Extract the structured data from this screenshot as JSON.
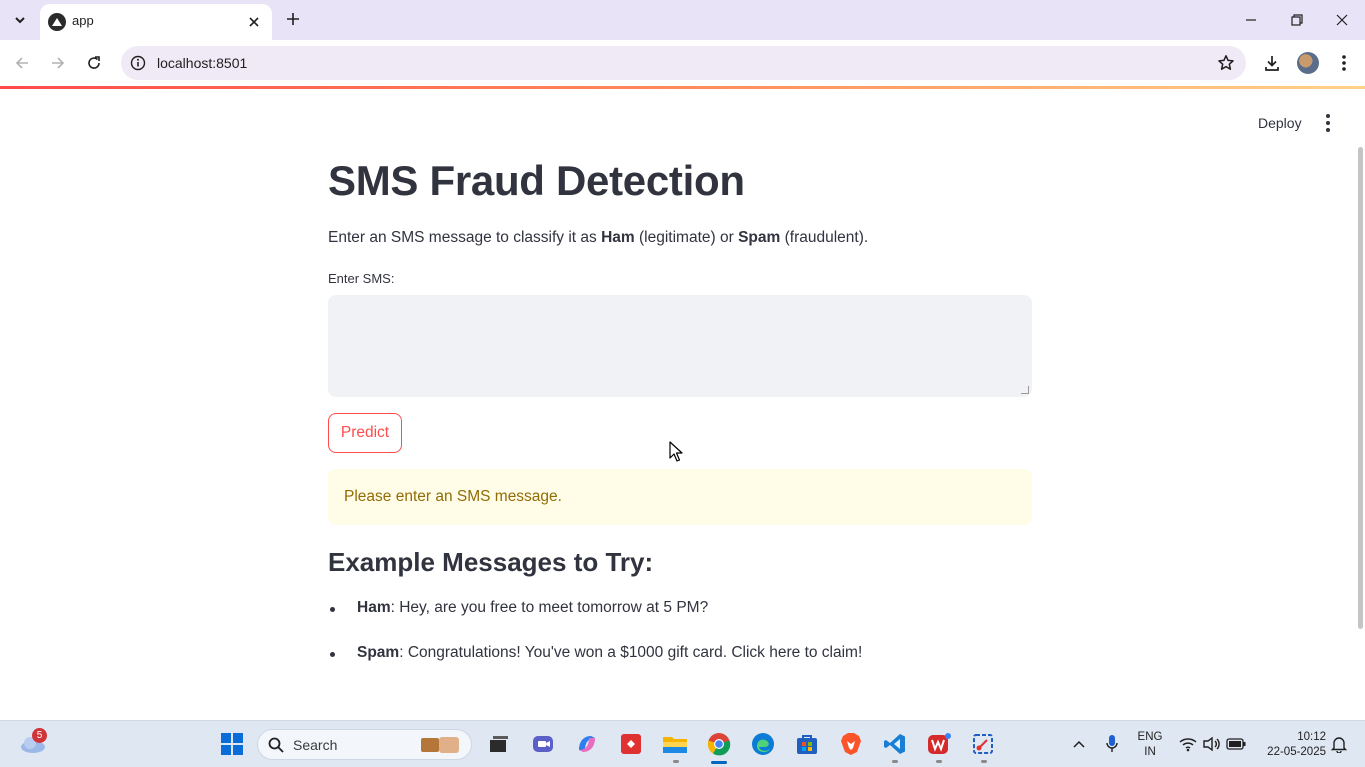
{
  "browser": {
    "tab_title": "app",
    "url": "localhost:8501"
  },
  "app": {
    "deploy_label": "Deploy",
    "title": "SMS Fraud Detection",
    "intro": {
      "part1": "Enter an SMS message to classify it as ",
      "ham": "Ham",
      "part2": " (legitimate) or ",
      "spam": "Spam",
      "part3": " (fraudulent)."
    },
    "input_label": "Enter SMS:",
    "input_value": "",
    "predict_label": "Predict",
    "warning": "Please enter an SMS message.",
    "examples_heading": "Example Messages to Try:",
    "examples": [
      {
        "label": "Ham",
        "text": ": Hey, are you free to meet tomorrow at 5 PM?"
      },
      {
        "label": "Spam",
        "text": ": Congratulations! You've won a $1000 gift card. Click here to claim!"
      }
    ]
  },
  "taskbar": {
    "weather_badge": "5",
    "search_placeholder": "Search",
    "lang_line1": "ENG",
    "lang_line2": "IN",
    "time": "10:12",
    "date": "22-05-2025"
  },
  "colors": {
    "accent": "#ff4b4b",
    "warning_bg": "#fffce7",
    "warning_text": "#926c05",
    "text": "#31333f"
  }
}
